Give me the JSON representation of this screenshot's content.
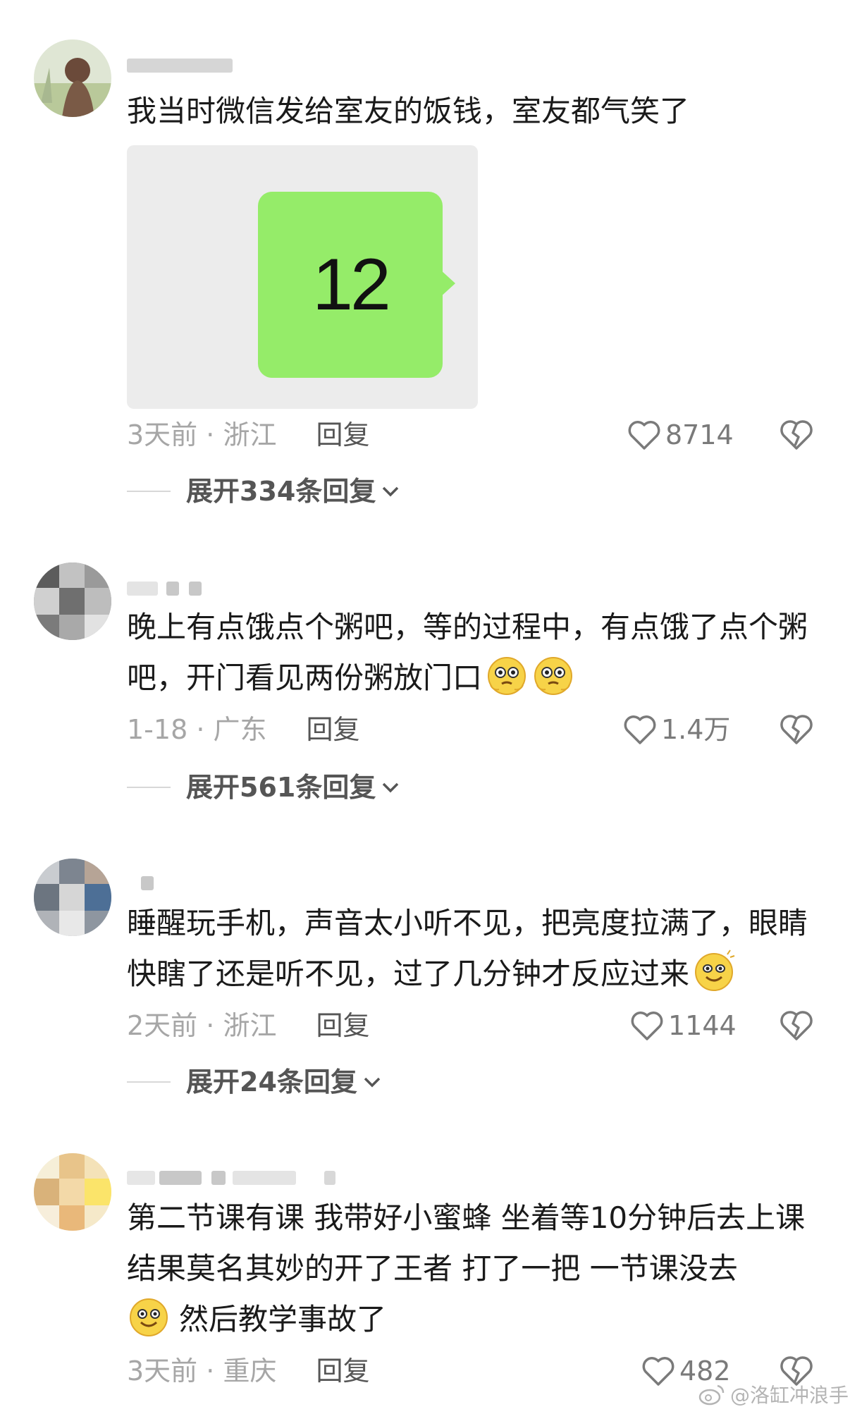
{
  "comments": [
    {
      "text": "我当时微信发给室友的饭钱，室友都气笑了",
      "image_text": "12",
      "time": "3天前",
      "location": "浙江",
      "reply": "回复",
      "likes": "8714",
      "expand": "展开334条回复"
    },
    {
      "text": "晚上有点饿点个粥吧，等的过程中，有点饿了点个粥吧，开门看见两份粥放门口",
      "time": "1-18",
      "location": "广东",
      "reply": "回复",
      "likes": "1.4万",
      "expand": "展开561条回复"
    },
    {
      "text": "睡醒玩手机，声音太小听不见，把亮度拉满了，眼睛快瞎了还是听不见，过了几分钟才反应过来",
      "time": "2天前",
      "location": "浙江",
      "reply": "回复",
      "likes": "1144",
      "expand": "展开24条回复"
    },
    {
      "text_before_emoji": "第二节课有课 我带好小蜜蜂 坐着等10分钟后去上课 结果莫名其妙的开了王者 打了一把 一节课没去",
      "text_after_emoji": "然后教学事故了",
      "time": "3天前",
      "location": "重庆",
      "reply": "回复",
      "likes": "482"
    }
  ],
  "meta_separator": " · ",
  "watermark": "@洛缸冲浪手",
  "colors": {
    "bubble": "#95ec69",
    "meta": "#a6a6a6",
    "text": "#1a1a1a"
  },
  "icons": [
    "heart-icon",
    "broken-heart-icon",
    "chevron-down-icon",
    "weibo-icon"
  ]
}
